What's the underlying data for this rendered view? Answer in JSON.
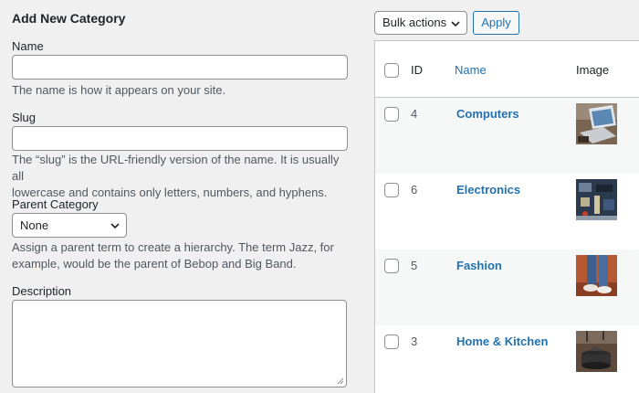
{
  "form": {
    "title": "Add New Category",
    "name_label": "Name",
    "name_value": "",
    "name_help": "The name is how it appears on your site.",
    "slug_label": "Slug",
    "slug_value": "",
    "slug_help_line1": "The “slug” is the URL-friendly version of the name. It is usually all",
    "slug_help_line2": "lowercase and contains only letters, numbers, and hyphens.",
    "parent_label": "Parent Category",
    "parent_selected": "None",
    "parent_help_line1": "Assign a parent term to create a hierarchy. The term Jazz, for",
    "parent_help_line2": "example, would be the parent of Bebop and Big Band.",
    "description_label": "Description"
  },
  "toolbar": {
    "bulk_selected": "Bulk actions",
    "apply_label": "Apply"
  },
  "table": {
    "columns": {
      "id": "ID",
      "name": "Name",
      "image": "Image"
    },
    "rows": [
      {
        "id": "4",
        "name": "Computers",
        "image": "laptop-photo"
      },
      {
        "id": "6",
        "name": "Electronics",
        "image": "circuit-board-photo"
      },
      {
        "id": "5",
        "name": "Fashion",
        "image": "jeans-sneakers-photo"
      },
      {
        "id": "3",
        "name": "Home & Kitchen",
        "image": "cooking-pot-photo"
      }
    ]
  },
  "colors": {
    "link": "#2271b1",
    "border": "#8c8f94",
    "background": "#f0f0f1",
    "row_alt": "#f6f7f7"
  }
}
